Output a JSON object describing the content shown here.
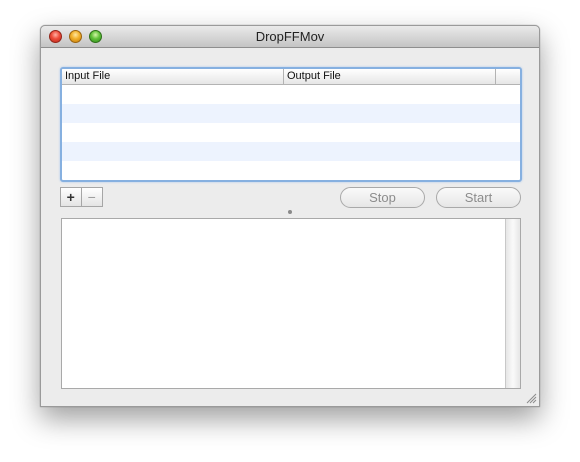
{
  "window": {
    "title": "DropFFMov"
  },
  "table": {
    "columns": [
      "Input File",
      "Output File",
      ""
    ],
    "rows": []
  },
  "toolbar": {
    "add_label": "+",
    "remove_label": "−",
    "stop_label": "Stop",
    "start_label": "Start"
  },
  "log": {
    "text": ""
  },
  "colors": {
    "selection_border": "#86b0e0",
    "alt_row": "#edf3fe",
    "window_bg": "#ececec"
  },
  "icons": [
    "close-icon",
    "minimize-icon",
    "zoom-icon",
    "resize-grip-icon",
    "splitter-handle-icon"
  ]
}
